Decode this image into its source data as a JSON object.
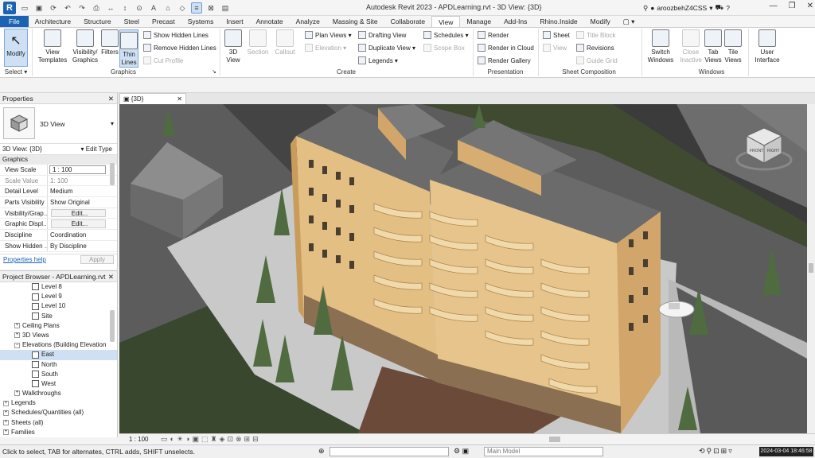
{
  "window": {
    "title": "Autodesk Revit 2023 - APDLearning.rvt - 3D View: {3D}",
    "user": "aroozbehZ4CSS",
    "logo": "R",
    "controls": [
      "—",
      "❐",
      "✕"
    ]
  },
  "quick_access": [
    "open-icon",
    "save-icon",
    "sync-icon",
    "undo-icon",
    "redo-icon",
    "print-icon",
    "measure-icon",
    "dimension-icon",
    "tag-icon",
    "text-icon",
    "3d-view-icon",
    "section-icon",
    "thin-lines-icon",
    "close-hidden-icon",
    "switch-windows-icon"
  ],
  "menu_tabs": [
    "File",
    "Architecture",
    "Structure",
    "Steel",
    "Precast",
    "Systems",
    "Insert",
    "Annotate",
    "Analyze",
    "Massing & Site",
    "Collaborate",
    "View",
    "Manage",
    "Add-Ins",
    "Rhino.Inside",
    "Modify",
    "▢ ▾"
  ],
  "active_tab": "View",
  "ribbon": {
    "select": {
      "big": "Modify",
      "panel": "Select ▾"
    },
    "graphics": {
      "view_templates": "View\nTemplates",
      "visibility": "Visibility/\nGraphics",
      "filters": "Filters",
      "thin_lines": "Thin\nLines",
      "show_hidden": "Show  Hidden Lines",
      "remove_hidden": "Remove  Hidden Lines",
      "cut_profile": "Cut  Profile",
      "panel": "Graphics"
    },
    "create": {
      "view3d": "3D\nView",
      "section": "Section",
      "callout": "Callout",
      "plan_views": "Plan  Views ▾",
      "elevation": "Elevation ▾",
      "drafting": "Drafting  View",
      "duplicate": "Duplicate  View ▾",
      "legends": "Legends ▾",
      "schedules": "Schedules ▾",
      "scope_box": "Scope  Box",
      "panel": "Create"
    },
    "presentation": {
      "render": "Render",
      "render_cloud": "Render  in Cloud",
      "render_gallery": "Render  Gallery",
      "panel": "Presentation"
    },
    "sheet": {
      "sheet": "Sheet",
      "view": "View",
      "title_block": "Title  Block",
      "revisions": "Revisions",
      "guide_grid": "Guide  Grid",
      "panel": "Sheet Composition"
    },
    "windows": {
      "switch": "Switch\nWindows",
      "close_inactive": "Close\nInactive",
      "tab_views": "Tab\nViews",
      "tile_views": "Tile\nViews",
      "panel": "Windows"
    },
    "user_interface": "User\nInterface"
  },
  "properties": {
    "header": "Properties",
    "type_name": "3D View",
    "instance": "3D View: {3D}",
    "edit_type": "Edit Type",
    "group": "Graphics",
    "rows": [
      {
        "k": "View Scale",
        "v": "1 : 100"
      },
      {
        "k": "Scale Value",
        "v": "100"
      },
      {
        "k": "Detail Level",
        "v": "Medium"
      },
      {
        "k": "Parts Visibility",
        "v": "Show Original"
      },
      {
        "k": "Visibility/Grap...",
        "v": "Edit..."
      },
      {
        "k": "Graphic Displ...",
        "v": "Edit..."
      },
      {
        "k": "Discipline",
        "v": "Coordination"
      },
      {
        "k": "Show Hidden ...",
        "v": "By Discipline"
      }
    ],
    "scale_prefix": "1:",
    "help": "Properties help",
    "apply": "Apply"
  },
  "browser": {
    "header": "Project Browser - APDLearning.rvt",
    "items": [
      {
        "label": "Level 8",
        "indent": 40,
        "type": "view"
      },
      {
        "label": "Level 9",
        "indent": 40,
        "type": "view"
      },
      {
        "label": "Level 10",
        "indent": 40,
        "type": "view"
      },
      {
        "label": "Site",
        "indent": 40,
        "type": "view"
      },
      {
        "label": "Ceiling Plans",
        "indent": 18,
        "type": "plus"
      },
      {
        "label": "3D Views",
        "indent": 18,
        "type": "plus"
      },
      {
        "label": "Elevations (Building Elevation",
        "indent": 18,
        "type": "minus"
      },
      {
        "label": "East",
        "indent": 40,
        "type": "view",
        "selected": true
      },
      {
        "label": "North",
        "indent": 40,
        "type": "view"
      },
      {
        "label": "South",
        "indent": 40,
        "type": "view"
      },
      {
        "label": "West",
        "indent": 40,
        "type": "view"
      },
      {
        "label": "Walkthroughs",
        "indent": 18,
        "type": "plus"
      },
      {
        "label": "Legends",
        "indent": 4,
        "type": "plus"
      },
      {
        "label": "Schedules/Quantities (all)",
        "indent": 4,
        "type": "plus"
      },
      {
        "label": "Sheets (all)",
        "indent": 4,
        "type": "plus"
      },
      {
        "label": "Families",
        "indent": 4,
        "type": "plus"
      }
    ]
  },
  "view_tab": {
    "label": "{3D}",
    "close": "✕"
  },
  "viewcube": {
    "front": "FRONT",
    "right": "RIGHT"
  },
  "view_control": {
    "scale": "1 : 100"
  },
  "status": {
    "text": "Click to select, TAB for alternates, CTRL adds, SHIFT unselects.",
    "model": "Main Model",
    "timestamp": "2024-03-04  18:46:58"
  },
  "colors": {
    "accent": "#1b62b3",
    "facade": "#e3bf84",
    "roof": "#6b6b6b",
    "grass": "#3f4a31",
    "road": "#555555"
  }
}
